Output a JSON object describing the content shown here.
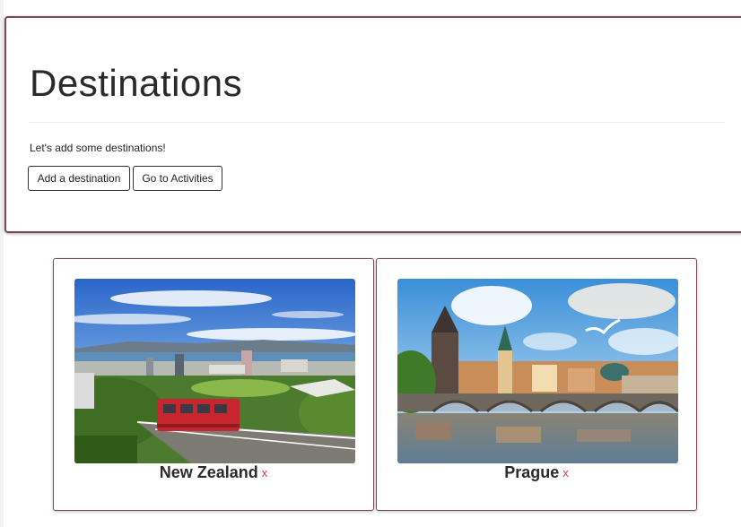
{
  "hero": {
    "title": "Destinations",
    "lead": "Let's add some destinations!",
    "add_button_label": "Add a destination",
    "activities_button_label": "Go to Activities"
  },
  "destinations": [
    {
      "name": "New Zealand",
      "remove_label": "x",
      "image": "photo-wellington-cable-car"
    },
    {
      "name": "Prague",
      "remove_label": "x",
      "image": "photo-charles-bridge"
    }
  ],
  "colors": {
    "accent_border": "#7b4a5a",
    "remove": "#dc3545"
  }
}
